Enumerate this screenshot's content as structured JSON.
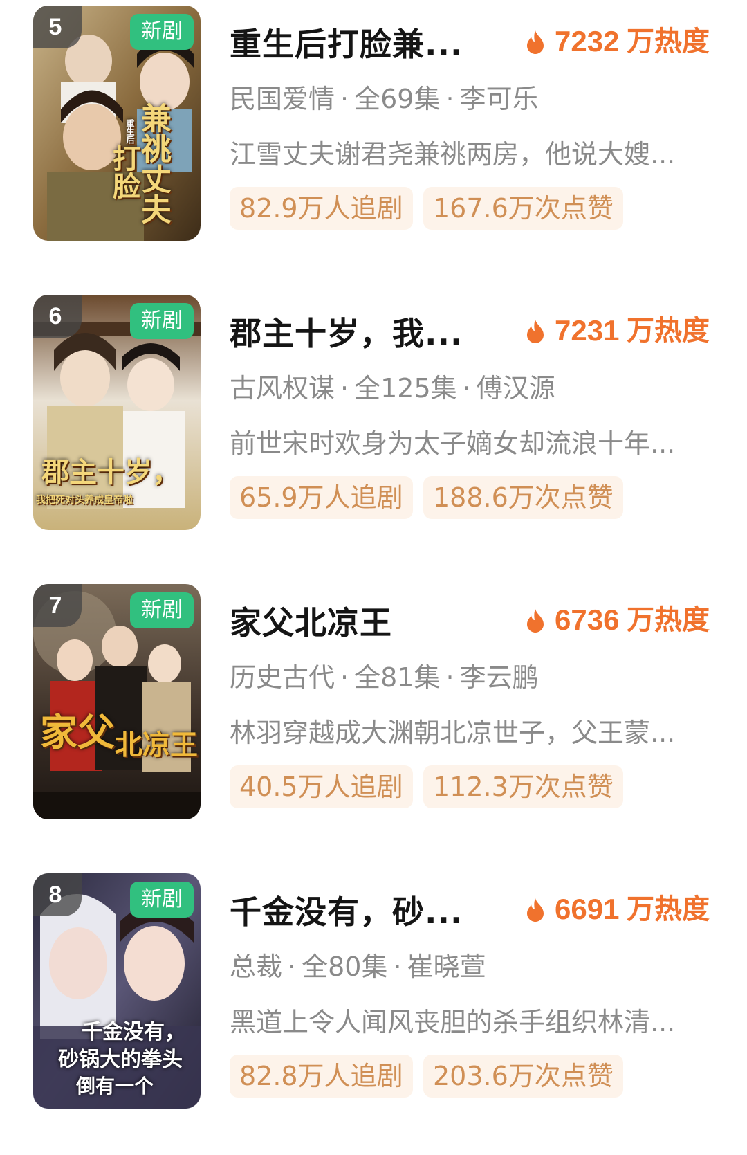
{
  "colors": {
    "accent_orange": "#f0722d",
    "new_badge_green": "#31c07f",
    "tag_bg": "#fdf3ea",
    "tag_text": "#d08f55",
    "meta_text": "#8a8a8a"
  },
  "items": [
    {
      "rank": "5",
      "new_label": "新剧",
      "title": "重生后打脸兼...",
      "heat_value": "7232",
      "heat_unit": "万热度",
      "heat_icon": "flame-icon",
      "genre": "民国爱情",
      "dot1": "·",
      "episodes": "全69集",
      "dot2": "·",
      "actor": "李可乐",
      "description": "江雪丈夫谢君尧兼祧两房，他说大嫂...",
      "followers": "82.9万人追剧",
      "likes": "167.6万次点赞",
      "poster_text": [
        "重生后",
        "打脸",
        "兼祧丈夫"
      ]
    },
    {
      "rank": "6",
      "new_label": "新剧",
      "title": "郡主十岁，我...",
      "heat_value": "7231",
      "heat_unit": "万热度",
      "heat_icon": "flame-icon",
      "genre": "古风权谋",
      "dot1": "·",
      "episodes": "全125集",
      "dot2": "·",
      "actor": "傅汉源",
      "description": "前世宋时欢身为太子嫡女却流浪十年...",
      "followers": "65.9万人追剧",
      "likes": "188.6万次点赞",
      "poster_text": [
        "郡主十岁，",
        "我把死对头养成皇帝啦"
      ]
    },
    {
      "rank": "7",
      "new_label": "新剧",
      "title": "家父北凉王",
      "heat_value": "6736",
      "heat_unit": "万热度",
      "heat_icon": "flame-icon",
      "genre": "历史古代",
      "dot1": "·",
      "episodes": "全81集",
      "dot2": "·",
      "actor": "李云鹏",
      "description": "林羽穿越成大渊朝北凉世子，父王蒙...",
      "followers": "40.5万人追剧",
      "likes": "112.3万次点赞",
      "poster_text": [
        "家父",
        "北凉王"
      ]
    },
    {
      "rank": "8",
      "new_label": "新剧",
      "title": "千金没有，砂...",
      "heat_value": "6691",
      "heat_unit": "万热度",
      "heat_icon": "flame-icon",
      "genre": "总裁",
      "dot1": "·",
      "episodes": "全80集",
      "dot2": "·",
      "actor": "崔晓萱",
      "description": "黑道上令人闻风丧胆的杀手组织林清...",
      "followers": "82.8万人追剧",
      "likes": "203.6万次点赞",
      "poster_text": [
        "千金没有，",
        "砂锅大的拳头",
        "倒有一个"
      ]
    }
  ]
}
